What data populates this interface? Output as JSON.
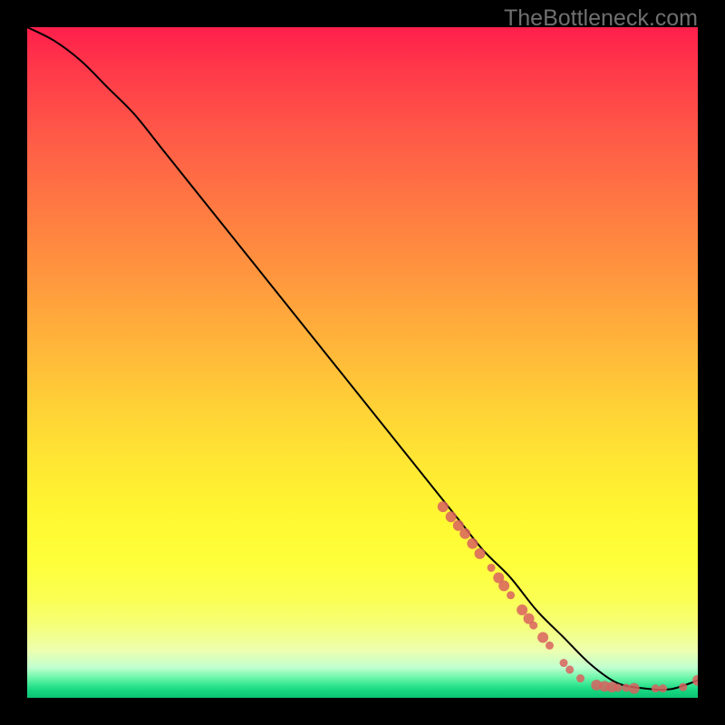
{
  "watermark": "TheBottleneck.com",
  "colors": {
    "frame": "#000000",
    "curve": "#000000",
    "dot": "#d9615f"
  },
  "chart_data": {
    "type": "line",
    "title": "",
    "xlabel": "",
    "ylabel": "",
    "xlim": [
      0,
      100
    ],
    "ylim": [
      0,
      100
    ],
    "grid": false,
    "series": [
      {
        "name": "curve",
        "x": [
          0,
          4,
          8,
          12,
          16,
          20,
          24,
          28,
          32,
          36,
          40,
          44,
          48,
          52,
          56,
          60,
          64,
          68,
          72,
          76,
          80,
          84,
          88,
          92,
          96,
          100
        ],
        "values": [
          100,
          98,
          95,
          91,
          87,
          82,
          77,
          72,
          67,
          62,
          57,
          52,
          47,
          42,
          37,
          32,
          27,
          22,
          18,
          13,
          9,
          5,
          2.2,
          1.4,
          1.3,
          2.6
        ]
      }
    ],
    "dots": {
      "name": "markers",
      "points": [
        {
          "x": 62.0,
          "y": 28.5,
          "r": 6
        },
        {
          "x": 63.2,
          "y": 27.0,
          "r": 6
        },
        {
          "x": 64.3,
          "y": 25.7,
          "r": 6
        },
        {
          "x": 65.3,
          "y": 24.5,
          "r": 6
        },
        {
          "x": 66.4,
          "y": 23.0,
          "r": 6
        },
        {
          "x": 67.5,
          "y": 21.5,
          "r": 6
        },
        {
          "x": 69.2,
          "y": 19.4,
          "r": 4.5
        },
        {
          "x": 70.3,
          "y": 17.9,
          "r": 6
        },
        {
          "x": 71.1,
          "y": 16.7,
          "r": 6
        },
        {
          "x": 72.1,
          "y": 15.3,
          "r": 4.5
        },
        {
          "x": 73.8,
          "y": 13.1,
          "r": 6
        },
        {
          "x": 74.8,
          "y": 11.8,
          "r": 6
        },
        {
          "x": 75.5,
          "y": 10.8,
          "r": 4.5
        },
        {
          "x": 76.9,
          "y": 9.0,
          "r": 6
        },
        {
          "x": 77.9,
          "y": 7.8,
          "r": 4.5
        },
        {
          "x": 80.0,
          "y": 5.2,
          "r": 4.5
        },
        {
          "x": 80.9,
          "y": 4.2,
          "r": 4.5
        },
        {
          "x": 82.5,
          "y": 2.9,
          "r": 4.5
        },
        {
          "x": 84.9,
          "y": 1.9,
          "r": 6
        },
        {
          "x": 86.1,
          "y": 1.7,
          "r": 6
        },
        {
          "x": 87.2,
          "y": 1.6,
          "r": 6
        },
        {
          "x": 88.1,
          "y": 1.5,
          "r": 4.5
        },
        {
          "x": 89.3,
          "y": 1.5,
          "r": 4.5
        },
        {
          "x": 90.5,
          "y": 1.4,
          "r": 6
        },
        {
          "x": 93.7,
          "y": 1.4,
          "r": 4.5
        },
        {
          "x": 94.8,
          "y": 1.4,
          "r": 4.5
        },
        {
          "x": 97.8,
          "y": 1.6,
          "r": 4.5
        },
        {
          "x": 100.0,
          "y": 2.6,
          "r": 6
        }
      ]
    }
  }
}
